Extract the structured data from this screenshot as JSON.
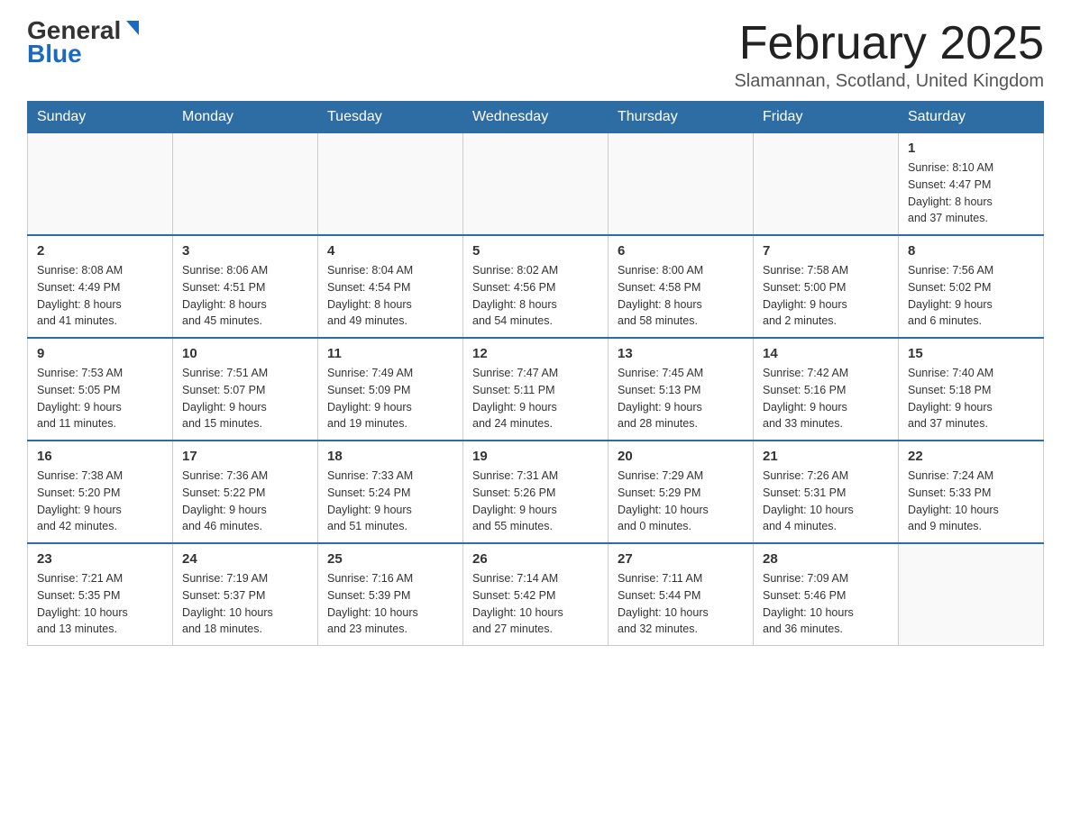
{
  "header": {
    "logo": {
      "general": "General",
      "blue": "Blue"
    },
    "title": "February 2025",
    "location": "Slamannan, Scotland, United Kingdom"
  },
  "days_of_week": [
    "Sunday",
    "Monday",
    "Tuesday",
    "Wednesday",
    "Thursday",
    "Friday",
    "Saturday"
  ],
  "weeks": [
    [
      {
        "day": "",
        "info": ""
      },
      {
        "day": "",
        "info": ""
      },
      {
        "day": "",
        "info": ""
      },
      {
        "day": "",
        "info": ""
      },
      {
        "day": "",
        "info": ""
      },
      {
        "day": "",
        "info": ""
      },
      {
        "day": "1",
        "info": "Sunrise: 8:10 AM\nSunset: 4:47 PM\nDaylight: 8 hours\nand 37 minutes."
      }
    ],
    [
      {
        "day": "2",
        "info": "Sunrise: 8:08 AM\nSunset: 4:49 PM\nDaylight: 8 hours\nand 41 minutes."
      },
      {
        "day": "3",
        "info": "Sunrise: 8:06 AM\nSunset: 4:51 PM\nDaylight: 8 hours\nand 45 minutes."
      },
      {
        "day": "4",
        "info": "Sunrise: 8:04 AM\nSunset: 4:54 PM\nDaylight: 8 hours\nand 49 minutes."
      },
      {
        "day": "5",
        "info": "Sunrise: 8:02 AM\nSunset: 4:56 PM\nDaylight: 8 hours\nand 54 minutes."
      },
      {
        "day": "6",
        "info": "Sunrise: 8:00 AM\nSunset: 4:58 PM\nDaylight: 8 hours\nand 58 minutes."
      },
      {
        "day": "7",
        "info": "Sunrise: 7:58 AM\nSunset: 5:00 PM\nDaylight: 9 hours\nand 2 minutes."
      },
      {
        "day": "8",
        "info": "Sunrise: 7:56 AM\nSunset: 5:02 PM\nDaylight: 9 hours\nand 6 minutes."
      }
    ],
    [
      {
        "day": "9",
        "info": "Sunrise: 7:53 AM\nSunset: 5:05 PM\nDaylight: 9 hours\nand 11 minutes."
      },
      {
        "day": "10",
        "info": "Sunrise: 7:51 AM\nSunset: 5:07 PM\nDaylight: 9 hours\nand 15 minutes."
      },
      {
        "day": "11",
        "info": "Sunrise: 7:49 AM\nSunset: 5:09 PM\nDaylight: 9 hours\nand 19 minutes."
      },
      {
        "day": "12",
        "info": "Sunrise: 7:47 AM\nSunset: 5:11 PM\nDaylight: 9 hours\nand 24 minutes."
      },
      {
        "day": "13",
        "info": "Sunrise: 7:45 AM\nSunset: 5:13 PM\nDaylight: 9 hours\nand 28 minutes."
      },
      {
        "day": "14",
        "info": "Sunrise: 7:42 AM\nSunset: 5:16 PM\nDaylight: 9 hours\nand 33 minutes."
      },
      {
        "day": "15",
        "info": "Sunrise: 7:40 AM\nSunset: 5:18 PM\nDaylight: 9 hours\nand 37 minutes."
      }
    ],
    [
      {
        "day": "16",
        "info": "Sunrise: 7:38 AM\nSunset: 5:20 PM\nDaylight: 9 hours\nand 42 minutes."
      },
      {
        "day": "17",
        "info": "Sunrise: 7:36 AM\nSunset: 5:22 PM\nDaylight: 9 hours\nand 46 minutes."
      },
      {
        "day": "18",
        "info": "Sunrise: 7:33 AM\nSunset: 5:24 PM\nDaylight: 9 hours\nand 51 minutes."
      },
      {
        "day": "19",
        "info": "Sunrise: 7:31 AM\nSunset: 5:26 PM\nDaylight: 9 hours\nand 55 minutes."
      },
      {
        "day": "20",
        "info": "Sunrise: 7:29 AM\nSunset: 5:29 PM\nDaylight: 10 hours\nand 0 minutes."
      },
      {
        "day": "21",
        "info": "Sunrise: 7:26 AM\nSunset: 5:31 PM\nDaylight: 10 hours\nand 4 minutes."
      },
      {
        "day": "22",
        "info": "Sunrise: 7:24 AM\nSunset: 5:33 PM\nDaylight: 10 hours\nand 9 minutes."
      }
    ],
    [
      {
        "day": "23",
        "info": "Sunrise: 7:21 AM\nSunset: 5:35 PM\nDaylight: 10 hours\nand 13 minutes."
      },
      {
        "day": "24",
        "info": "Sunrise: 7:19 AM\nSunset: 5:37 PM\nDaylight: 10 hours\nand 18 minutes."
      },
      {
        "day": "25",
        "info": "Sunrise: 7:16 AM\nSunset: 5:39 PM\nDaylight: 10 hours\nand 23 minutes."
      },
      {
        "day": "26",
        "info": "Sunrise: 7:14 AM\nSunset: 5:42 PM\nDaylight: 10 hours\nand 27 minutes."
      },
      {
        "day": "27",
        "info": "Sunrise: 7:11 AM\nSunset: 5:44 PM\nDaylight: 10 hours\nand 32 minutes."
      },
      {
        "day": "28",
        "info": "Sunrise: 7:09 AM\nSunset: 5:46 PM\nDaylight: 10 hours\nand 36 minutes."
      },
      {
        "day": "",
        "info": ""
      }
    ]
  ]
}
